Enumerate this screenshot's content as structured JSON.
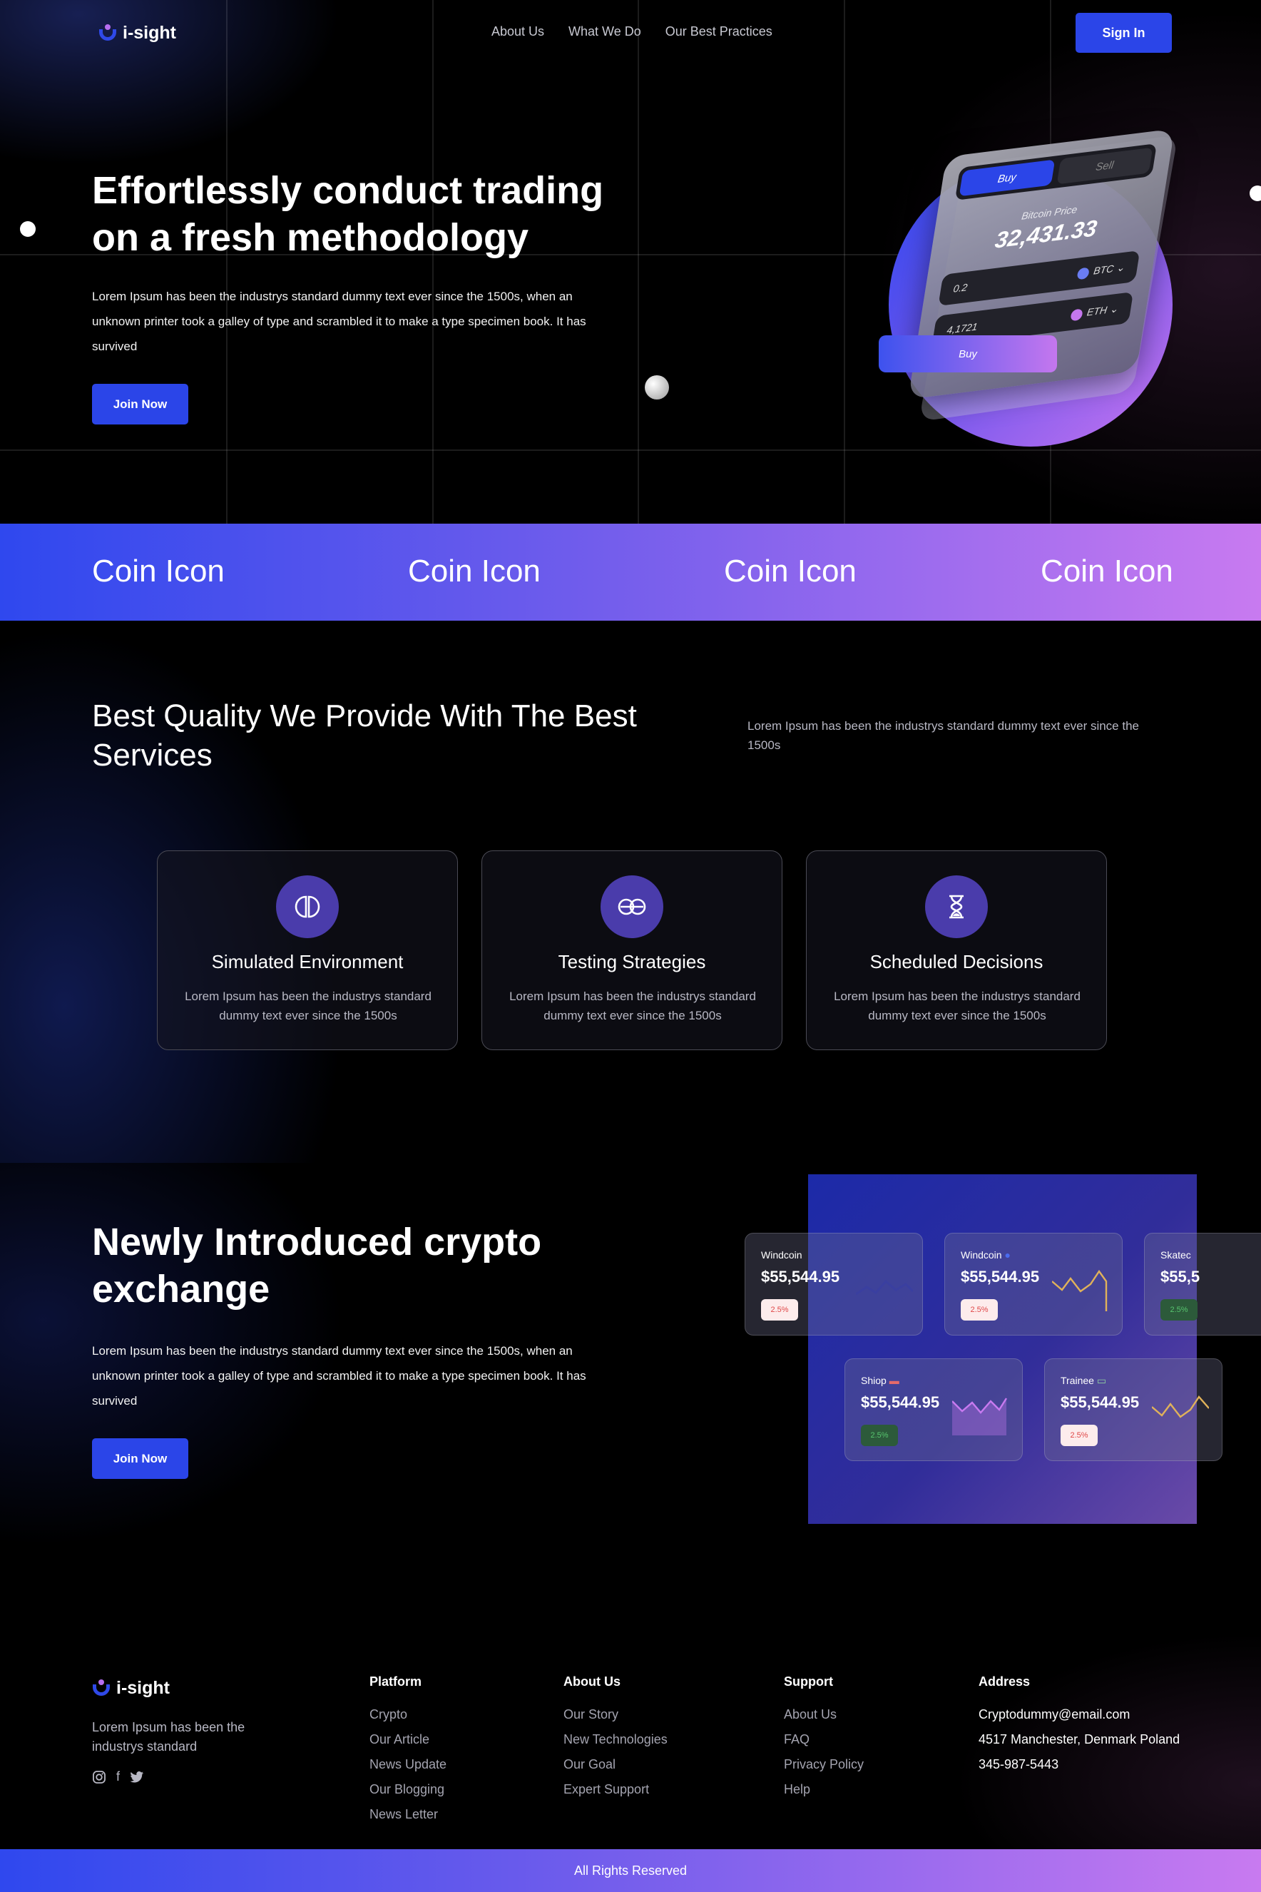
{
  "brand": {
    "name": "i-sight"
  },
  "nav": {
    "items": [
      "About Us",
      "What We Do",
      "Our Best Practices"
    ],
    "signin": "Sign In"
  },
  "hero": {
    "title": "Effortlessly conduct trading on a fresh methodology",
    "text": "Lorem Ipsum has been the industrys standard dummy text ever since the 1500s, when an unknown printer took a galley of type and scrambled it to make a type specimen book. It has survived",
    "cta": "Join Now",
    "card": {
      "tab_buy": "Buy",
      "tab_sell": "Sell",
      "price_label": "Bitcoin Price",
      "price": "32,431.33",
      "row1_amount": "0.2",
      "row1_coin": "BTC",
      "row2_amount": "4,1721",
      "row2_coin": "ETH",
      "buy_button": "Buy"
    }
  },
  "band": {
    "items": [
      "Coin Icon",
      "Coin Icon",
      "Coin Icon",
      "Coin Icon"
    ]
  },
  "services": {
    "title": "Best Quality We Provide With The Best Services",
    "text": "Lorem Ipsum has been the industrys standard dummy text ever since the 1500s",
    "cards": [
      {
        "icon": "split-circle-icon",
        "title": "Simulated Environment",
        "text": "Lorem Ipsum has been the industrys standard dummy text ever since the 1500s"
      },
      {
        "icon": "infinity-icon",
        "title": "Testing Strategies",
        "text": "Lorem Ipsum has been the industrys standard dummy text ever since the 1500s"
      },
      {
        "icon": "hourglass-icon",
        "title": "Scheduled Decisions",
        "text": "Lorem Ipsum has been the industrys standard dummy text ever since the 1500s"
      }
    ]
  },
  "exchange": {
    "title": "Newly Introduced crypto exchange",
    "text": "Lorem Ipsum has been the industrys standard dummy text ever since the 1500s, when an unknown printer took a galley of type and scrambled it to make a type specimen book. It has survived",
    "cta": "Join Now",
    "tickers": [
      {
        "name": "Windcoin",
        "price": "$55,544.95",
        "change": "2.5%",
        "trend": "down"
      },
      {
        "name": "Windcoin",
        "price": "$55,544.95",
        "change": "2.5%",
        "trend": "down"
      },
      {
        "name": "Skatec",
        "price": "$55,5",
        "change": "2.5%",
        "trend": "up"
      },
      {
        "name": "Shiop",
        "price": "$55,544.95",
        "change": "2.5%",
        "trend": "up"
      },
      {
        "name": "Trainee",
        "price": "$55,544.95",
        "change": "2.5%",
        "trend": "down"
      }
    ]
  },
  "footer": {
    "tagline": "Lorem Ipsum has been the industrys standard",
    "social": [
      "instagram-icon",
      "facebook-icon",
      "twitter-icon"
    ],
    "platform": {
      "title": "Platform",
      "links": [
        "Crypto",
        "Our Article",
        "News Update",
        "Our Blogging",
        "News Letter"
      ]
    },
    "about": {
      "title": "About Us",
      "links": [
        "Our Story",
        "New Technologies",
        "Our Goal",
        "Expert Support"
      ]
    },
    "support": {
      "title": "Support",
      "links": [
        "About Us",
        "FAQ",
        "Privacy Policy",
        "Help"
      ]
    },
    "address": {
      "title": "Address",
      "lines": [
        "Cryptodummy@email.com",
        "4517 Manchester, Denmark Poland",
        "345-987-5443"
      ]
    },
    "copyright": "All Rights Reserved"
  },
  "colors": {
    "accent": "#2b45e8",
    "gradient_start": "#2f48ee",
    "gradient_end": "#c87af0",
    "icon_bg": "#4a3cab"
  }
}
